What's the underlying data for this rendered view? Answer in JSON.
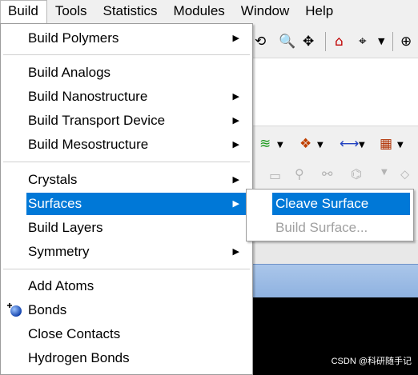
{
  "menubar": {
    "items": [
      "Build",
      "Tools",
      "Statistics",
      "Modules",
      "Window",
      "Help"
    ]
  },
  "build_menu": {
    "group1": [
      {
        "label": "Build Polymers",
        "submenu": true
      }
    ],
    "group2": [
      {
        "label": "Build Analogs",
        "submenu": false
      },
      {
        "label": "Build Nanostructure",
        "submenu": true
      },
      {
        "label": "Build Transport Device",
        "submenu": true
      },
      {
        "label": "Build Mesostructure",
        "submenu": true
      }
    ],
    "group3": [
      {
        "label": "Crystals",
        "submenu": true
      },
      {
        "label": "Surfaces",
        "submenu": true,
        "selected": true
      },
      {
        "label": "Build Layers",
        "submenu": false
      },
      {
        "label": "Symmetry",
        "submenu": true
      }
    ],
    "group4": [
      {
        "label": "Add Atoms",
        "icon": "add-atoms-icon"
      },
      {
        "label": "Bonds"
      },
      {
        "label": "Close Contacts"
      },
      {
        "label": "Hydrogen Bonds"
      }
    ]
  },
  "surfaces_submenu": {
    "items": [
      {
        "label": "Cleave Surface",
        "selected": true,
        "enabled": true
      },
      {
        "label": "Build Surface...",
        "enabled": false
      }
    ]
  },
  "toolbar_icons": [
    "rotate-icon",
    "zoom-icon",
    "pan-icon",
    "home-icon",
    "center-icon",
    "display-style-icon",
    "color-atoms-icon",
    "bond-icon",
    "fragment-icon"
  ],
  "arrow_glyph": "▶",
  "watermark": "CSDN @科研随手记",
  "colors": {
    "selection": "#0078d7",
    "disabled": "#a0a0a0"
  }
}
